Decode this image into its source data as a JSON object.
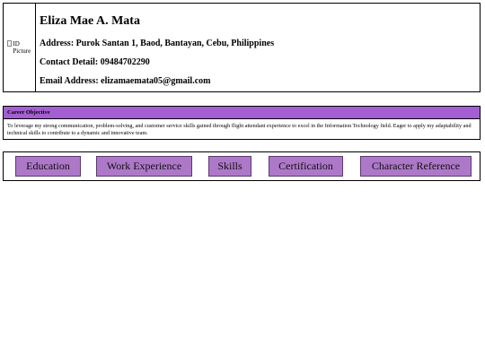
{
  "profile": {
    "photo_alt": "ID Picture",
    "name": "Eliza Mae A. Mata",
    "address": "Address: Purok Santan 1, Baod, Bantayan, Cebu, Philippines",
    "contact": "Contact Detail: 09484702290",
    "email": "Email Address: elizamaemata05@gmail.com"
  },
  "objective": {
    "title": "Career Objective",
    "text": "To leverage my strong communication, problem-solving, and customer service skills gained through flight attendant experience to excel in the Information Technology field. Eager to apply my adaptability and technical skills to contribute to a dynamic and innovative team."
  },
  "nav": {
    "items": [
      "Education",
      "Work Experience",
      "Skills",
      "Certification",
      "Character Reference"
    ]
  },
  "colors": {
    "objective_header": "#a35fd1",
    "nav_button": "#ae78c9"
  }
}
